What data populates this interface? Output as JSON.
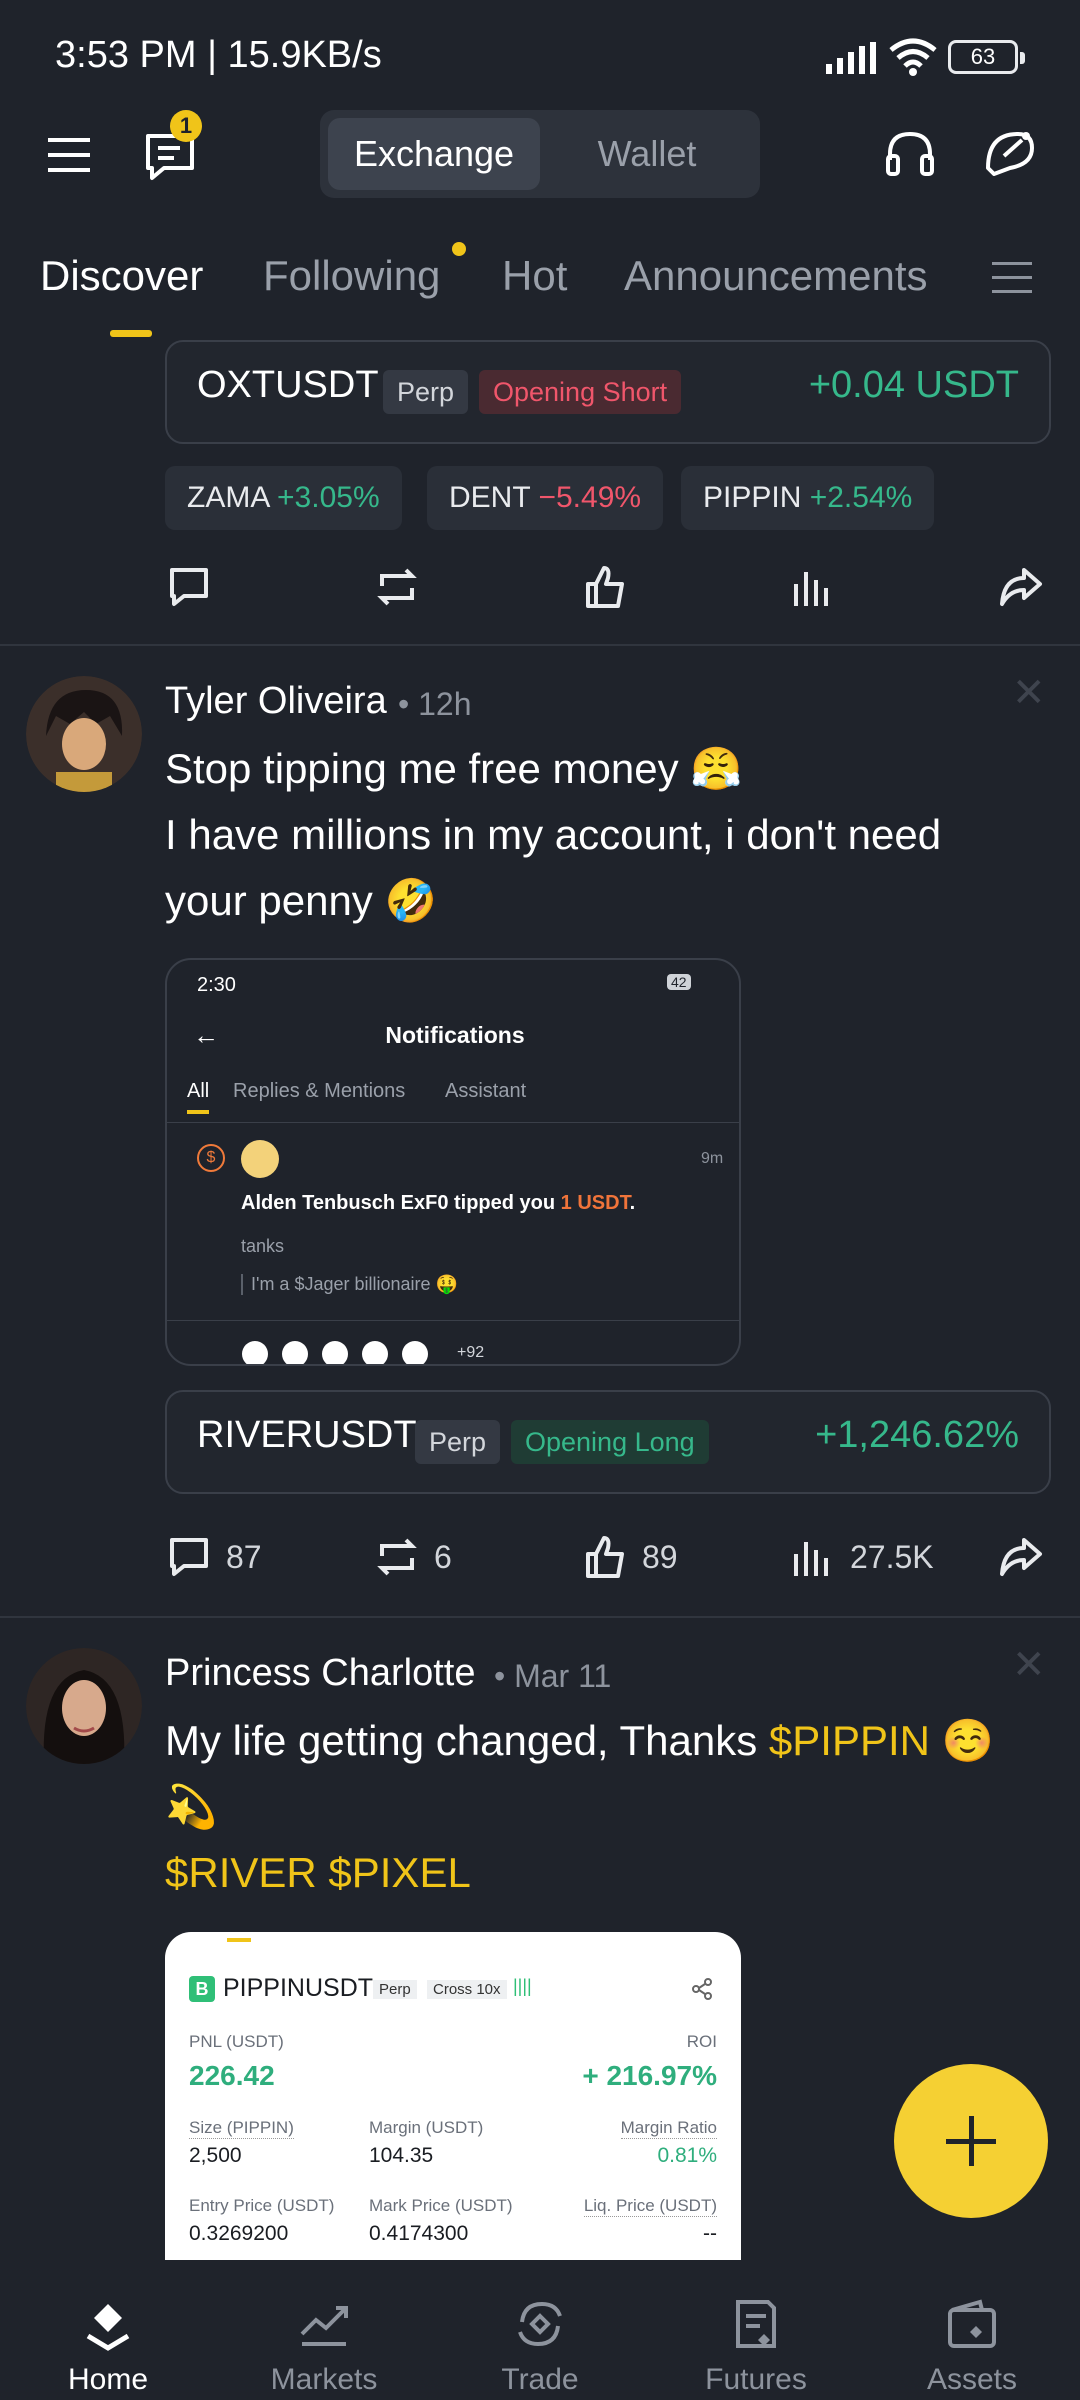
{
  "status": {
    "time": "3:53 PM | 15.9KB/s",
    "battery": "63"
  },
  "header": {
    "notif_badge": "1",
    "seg_exchange": "Exchange",
    "seg_wallet": "Wallet"
  },
  "tabs": [
    "Discover",
    "Following",
    "Hot",
    "Announcements"
  ],
  "top_trade": {
    "symbol": "OXTUSDT",
    "perp": "Perp",
    "side": "Opening Short",
    "pnl": "+0.04 USDT"
  },
  "tickers": [
    {
      "sym": "ZAMA",
      "chg": "+3.05%"
    },
    {
      "sym": "DENT",
      "chg": "−5.49%"
    },
    {
      "sym": "PIPPIN",
      "chg": "+2.54%"
    }
  ],
  "post1": {
    "name": "Tyler Oliveira",
    "time": "12h",
    "line1": "Stop tipping me free money 😤",
    "line2": "I have millions in my account, i don't need",
    "line3": "your penny 🤣",
    "shot": {
      "time": "2:30",
      "battery": "42",
      "title": "Notifications",
      "tab_all": "All",
      "tab_replies": "Replies & Mentions",
      "tab_assistant": "Assistant",
      "ago": "9m",
      "tip_text": "Alden Tenbusch ExF0 tipped you ",
      "tip_amount": "1 USDT",
      "tip_end": ".",
      "reply": "tanks",
      "quote": "I'm a $Jager billionaire 🤑",
      "more": "+92"
    },
    "trade": {
      "symbol": "RIVERUSDT",
      "perp": "Perp",
      "side": "Opening Long",
      "pnl": "+1,246.62%"
    },
    "stats": {
      "comments": "87",
      "reposts": "6",
      "likes": "89",
      "views": "27.5K"
    }
  },
  "post2": {
    "name": "Princess Charlotte",
    "time": "Mar 11",
    "line1_a": "My life getting changed, Thanks ",
    "line1_tag": "$PIPPIN",
    "line1_b": " ☺️",
    "line2": "💫",
    "line3": "$RIVER $PIXEL",
    "card": {
      "symbol": "PIPPINUSDT",
      "perp": "Perp",
      "cross": "Cross 10x",
      "pnl_label": "PNL (USDT)",
      "pnl": "226.42",
      "roi_label": "ROI",
      "roi": "+ 216.97%",
      "size_label": "Size (PIPPIN)",
      "size": "2,500",
      "margin_label": "Margin (USDT)",
      "margin": "104.35",
      "mratio_label": "Margin Ratio",
      "mratio": "0.81%",
      "entry_label": "Entry Price (USDT)",
      "entry": "0.3269200",
      "mark_label": "Mark Price (USDT)",
      "mark": "0.4174300",
      "liq_label": "Liq. Price (USDT)",
      "liq": "--"
    }
  },
  "nav": [
    "Home",
    "Markets",
    "Trade",
    "Futures",
    "Assets"
  ],
  "colors": {
    "accent": "#f0c419",
    "up": "#36b88b",
    "down": "#f0566b",
    "bg": "#1f232b"
  }
}
